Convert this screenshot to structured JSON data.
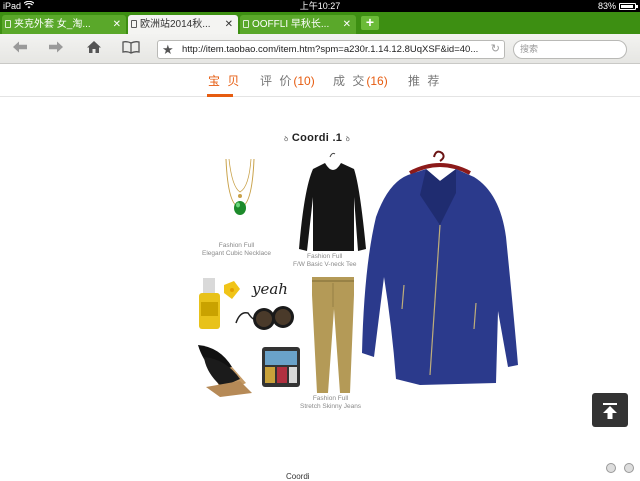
{
  "status_bar": {
    "device": "iPad",
    "time": "上午10:27",
    "battery": "83%"
  },
  "tabs": [
    {
      "label": "夹克外套 女_淘...",
      "state": "inactive"
    },
    {
      "label": "欧洲站2014秋...",
      "state": "active"
    },
    {
      "label": "OOFFLI 早秋长...",
      "state": "inactive"
    }
  ],
  "new_tab_label": "+",
  "toolbar": {
    "url": "http://item.taobao.com/item.htm?spm=a230r.1.14.12.8UqXSF&id=40...",
    "search_placeholder": "搜索"
  },
  "page_tabs": [
    {
      "label": "宝 贝",
      "count": "",
      "active": true
    },
    {
      "label": "评 价",
      "count": "(10)",
      "active": false
    },
    {
      "label": "成 交",
      "count": "(16)",
      "active": false
    },
    {
      "label": "推 荐",
      "count": "",
      "active": false
    }
  ],
  "coordi": {
    "title": "Coordi .1",
    "handwriting": "yeah",
    "captions": {
      "necklace": [
        "Fashion Full",
        "Elegant Cubic Necklace"
      ],
      "tee": [
        "Fashion Full",
        "F/W Basic V-neck Tee"
      ],
      "jeans": [
        "Fashion Full",
        "Stretch Skinny Jeans"
      ]
    },
    "next_title": "Coordi"
  },
  "colors": {
    "tab_bar": "#3d8f12",
    "accent": "#e65c10",
    "jacket": "#2b3a8c"
  }
}
